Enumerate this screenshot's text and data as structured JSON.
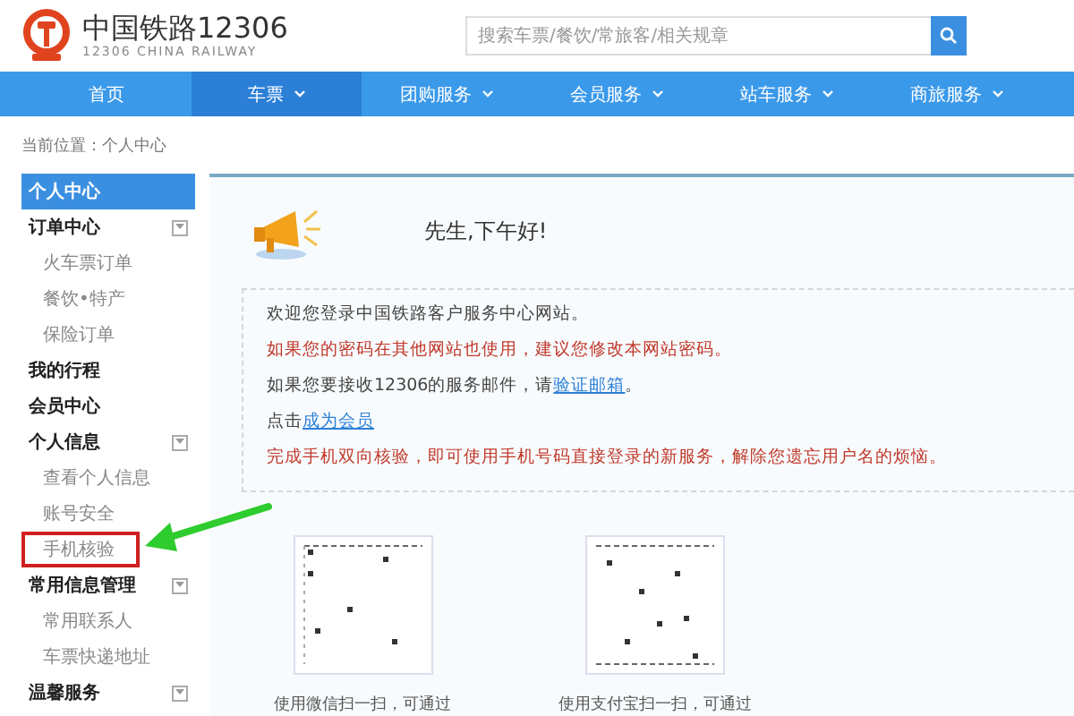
{
  "header": {
    "logo_title": "中国铁路12306",
    "logo_subtitle": "12306 CHINA RAILWAY",
    "search": {
      "placeholder": "搜索车票/餐饮/常旅客/相关规章"
    }
  },
  "nav": [
    {
      "label": "首页",
      "selected": false,
      "dropdown": false
    },
    {
      "label": "车票",
      "selected": true,
      "dropdown": true
    },
    {
      "label": "团购服务",
      "selected": false,
      "dropdown": true
    },
    {
      "label": "会员服务",
      "selected": false,
      "dropdown": true
    },
    {
      "label": "站车服务",
      "selected": false,
      "dropdown": true
    },
    {
      "label": "商旅服务",
      "selected": false,
      "dropdown": true
    }
  ],
  "breadcrumb": "当前位置：个人中心",
  "sidebar": [
    {
      "label": "个人中心",
      "selected": true
    },
    {
      "label": "订单中心",
      "selected": false,
      "expanded": true,
      "children": [
        {
          "label": "火车票订单",
          "highlighted": false
        },
        {
          "label": "餐饮•特产",
          "highlighted": false
        },
        {
          "label": "保险订单",
          "highlighted": false
        }
      ]
    },
    {
      "label": "我的行程",
      "selected": false
    },
    {
      "label": "会员中心",
      "selected": false
    },
    {
      "label": "个人信息",
      "selected": false,
      "expanded": true,
      "children": [
        {
          "label": "查看个人信息",
          "highlighted": false
        },
        {
          "label": "账号安全",
          "highlighted": false
        },
        {
          "label": "手机核验",
          "highlighted": true
        }
      ]
    },
    {
      "label": "常用信息管理",
      "selected": false,
      "expanded": true,
      "children": [
        {
          "label": "常用联系人",
          "highlighted": false
        },
        {
          "label": "车票快递地址",
          "highlighted": false
        }
      ]
    },
    {
      "label": "温馨服务",
      "selected": false,
      "expanded": true
    }
  ],
  "greeting": "先生,下午好!",
  "messages": [
    {
      "kind": "normal",
      "parts": [
        {
          "text": "欢迎您登录中国铁路客户服务中心网站。",
          "link": false
        }
      ]
    },
    {
      "kind": "warning",
      "parts": [
        {
          "text": "如果您的密码在其他网站也使用，建议您修改本网站密码。",
          "link": false
        }
      ]
    },
    {
      "kind": "normal",
      "parts": [
        {
          "text": "如果您要接收12306的服务邮件，请",
          "link": false
        },
        {
          "text": "验证邮箱",
          "link": true
        },
        {
          "text": "。",
          "link": false
        }
      ]
    },
    {
      "kind": "normal",
      "parts": [
        {
          "text": "点击",
          "link": false
        },
        {
          "text": "成为会员",
          "link": true
        }
      ]
    },
    {
      "kind": "warning",
      "parts": [
        {
          "text": "完成手机双向核验，即可使用手机号码直接登录的新服务，解除您遗忘用户名的烦恼。",
          "link": false
        }
      ]
    }
  ],
  "qr_codes": [
    {
      "caption": "使用微信扫一扫，可通过"
    },
    {
      "caption": "使用支付宝扫一扫，可通过"
    }
  ]
}
